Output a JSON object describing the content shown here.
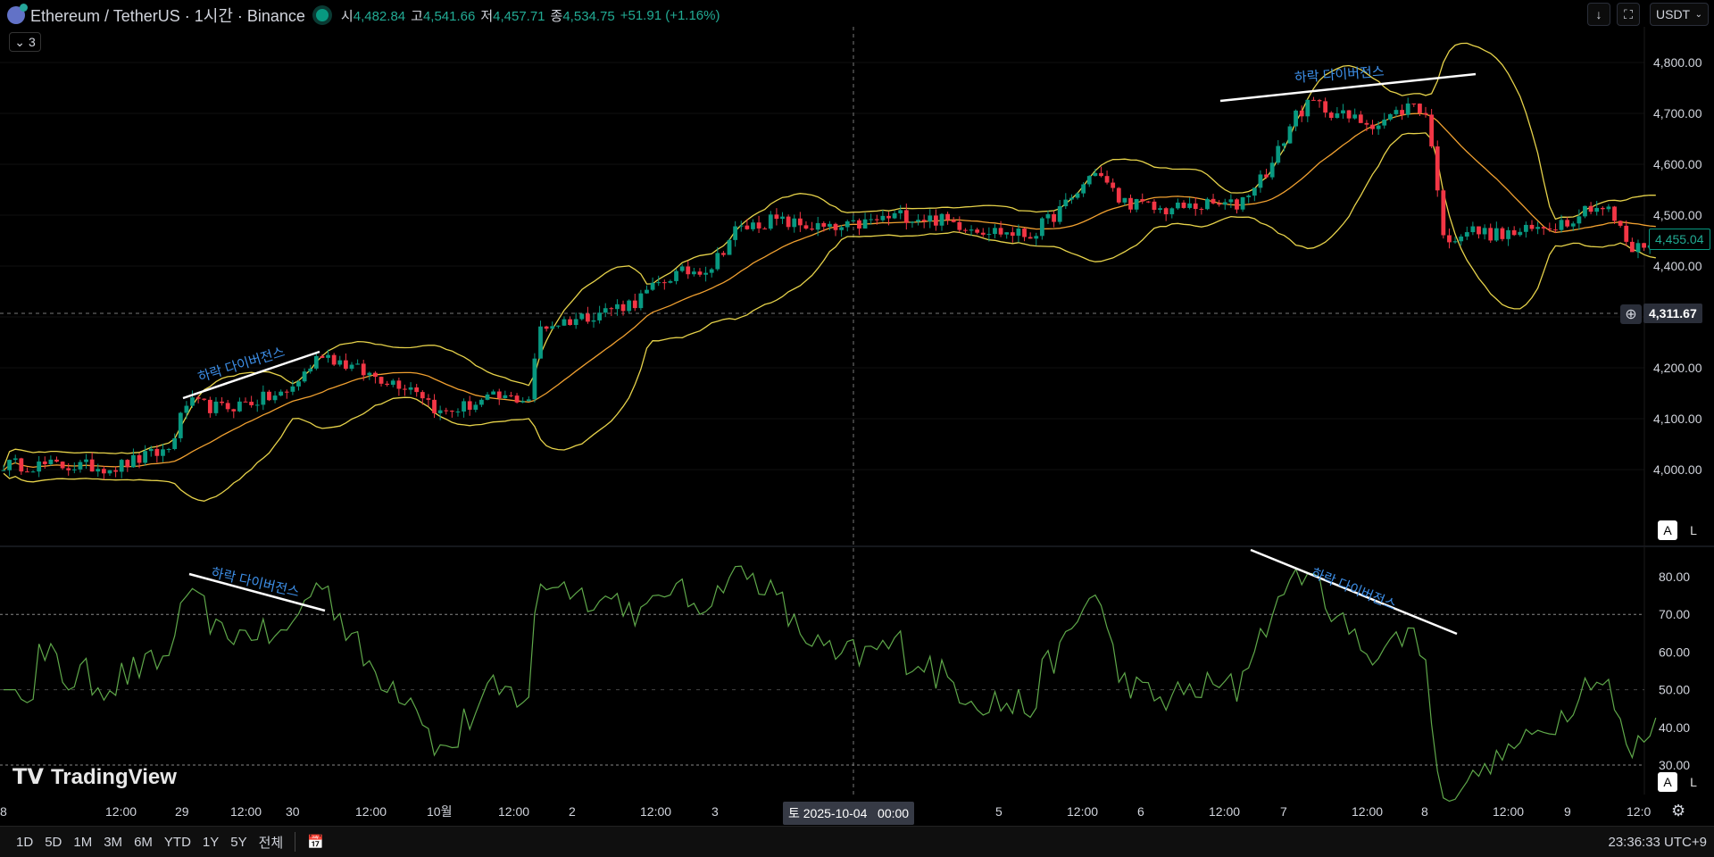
{
  "header": {
    "symbol": "Ethereum / TetherUS · 1시간 · Binance",
    "open_label": "시",
    "open": "4,482.84",
    "high_label": "고",
    "high": "4,541.66",
    "low_label": "저",
    "low": "4,457.71",
    "close_label": "종",
    "close": "4,534.75",
    "change": "+51.91 (+1.16%)",
    "indicators_count": "3"
  },
  "toolbar": {
    "currency": "USDT",
    "down_icon": "arrow-down-icon",
    "fullscreen_icon": "fullscreen-icon"
  },
  "price_axis": {
    "labels": [
      "4,800.00",
      "4,700.00",
      "4,600.00",
      "4,500.00",
      "4,400.00",
      "4,200.00",
      "4,100.00",
      "4,000.00"
    ],
    "last_price": "4,455.04",
    "crosshair_price": "4,311.67"
  },
  "rsi_axis": {
    "labels": [
      "80.00",
      "70.00",
      "60.00",
      "50.00",
      "40.00",
      "30.00"
    ]
  },
  "time_axis": {
    "labels": [
      "8",
      "12:00",
      "29",
      "12:00",
      "30",
      "12:00",
      "10월",
      "12:00",
      "2",
      "12:00",
      "3",
      "12:00",
      "5",
      "12:00",
      "6",
      "12:00",
      "7",
      "12:00",
      "8",
      "12:00",
      "9",
      "12:0"
    ],
    "crosshair_time": "토 2025-10-04   00:00"
  },
  "annotations": [
    "하락 다이버전스",
    "하락 다이버전스",
    "하락 다이버전스",
    "하락 다이버전스"
  ],
  "scale_buttons": {
    "auto": "A",
    "log": "L"
  },
  "bottom": {
    "ranges": [
      "1D",
      "5D",
      "1M",
      "3M",
      "6M",
      "YTD",
      "1Y",
      "5Y",
      "전체"
    ],
    "clock": "23:36:33 UTC+9"
  },
  "watermark": "TradingView",
  "colors": {
    "up": "#089981",
    "down": "#f23645",
    "bb_band": "#e6d24a",
    "bb_basis": "#f0a030",
    "rsi": "#5fa84a"
  },
  "chart_data": {
    "type": "candlestick",
    "title": "Ethereum / TetherUS 1H",
    "ylim": [
      3950,
      4830
    ],
    "rsi_ylim": [
      27,
      87
    ],
    "close_keypoints": [
      [
        0,
        4010
      ],
      [
        19,
        4005
      ],
      [
        28,
        4040
      ],
      [
        31,
        4130
      ],
      [
        37,
        4120
      ],
      [
        48,
        4150
      ],
      [
        54,
        4230
      ],
      [
        61,
        4190
      ],
      [
        70,
        4160
      ],
      [
        74,
        4110
      ],
      [
        83,
        4140
      ],
      [
        89,
        4140
      ],
      [
        91,
        4280
      ],
      [
        98,
        4300
      ],
      [
        107,
        4330
      ],
      [
        113,
        4380
      ],
      [
        120,
        4400
      ],
      [
        124,
        4470
      ],
      [
        130,
        4490
      ],
      [
        141,
        4470
      ],
      [
        148,
        4490
      ],
      [
        152,
        4500
      ],
      [
        159,
        4490
      ],
      [
        167,
        4470
      ],
      [
        174,
        4460
      ],
      [
        181,
        4530
      ],
      [
        185,
        4590
      ],
      [
        189,
        4530
      ],
      [
        196,
        4510
      ],
      [
        204,
        4520
      ],
      [
        209,
        4520
      ],
      [
        215,
        4600
      ],
      [
        219,
        4700
      ],
      [
        222,
        4720
      ],
      [
        228,
        4690
      ],
      [
        233,
        4680
      ],
      [
        239,
        4720
      ],
      [
        241,
        4700
      ],
      [
        243,
        4560
      ],
      [
        244,
        4450
      ],
      [
        248,
        4470
      ],
      [
        254,
        4460
      ],
      [
        259,
        4470
      ],
      [
        265,
        4490
      ],
      [
        269,
        4520
      ],
      [
        272,
        4510
      ],
      [
        276,
        4430
      ],
      [
        280,
        4455
      ]
    ],
    "indicators": [
      "Bollinger Bands (20,2)",
      "RSI (14)"
    ],
    "rsi_levels": [
      70,
      50,
      30
    ]
  }
}
